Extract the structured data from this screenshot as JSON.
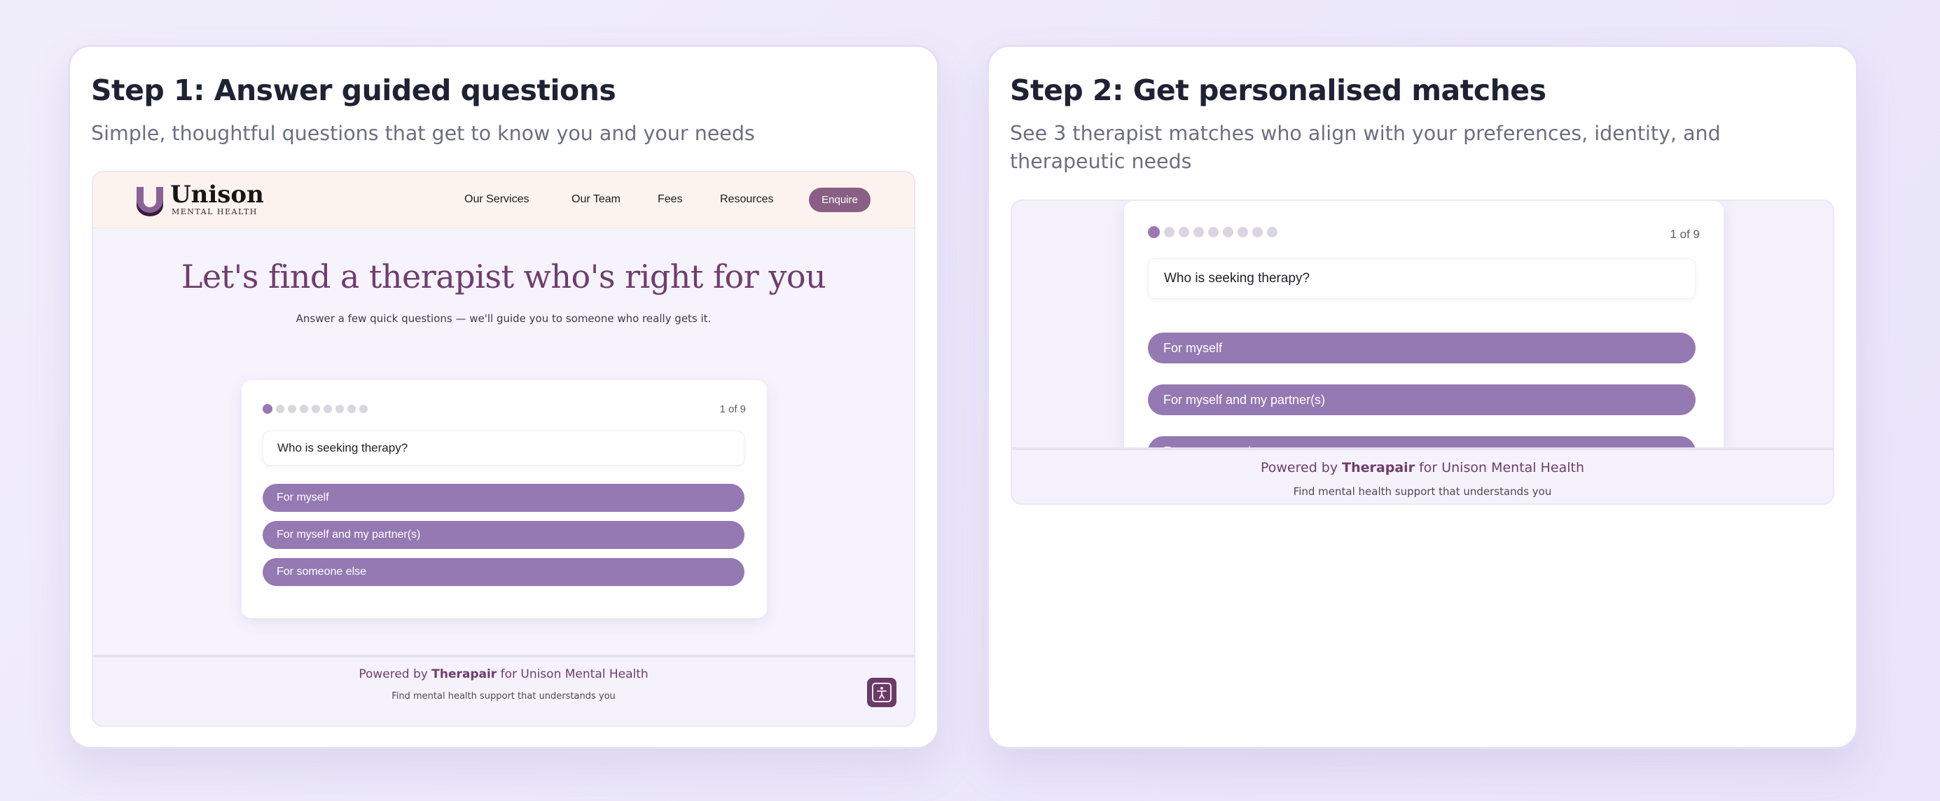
{
  "step1": {
    "title": "Step 1: Answer guided questions",
    "subtitle": "Simple, thoughtful questions that get to know you and your needs",
    "site": {
      "logo_word": "Unison",
      "logo_tagline": "MENTAL HEALTH",
      "nav": [
        "Our Services",
        "Our Team",
        "Fees",
        "Resources"
      ],
      "cta": "Enquire",
      "hero_title": "Let's find a therapist who's right for you",
      "hero_subtitle": "Answer a few quick questions — we'll guide you to someone who really gets it.",
      "quiz": {
        "progress": "1 of 9",
        "total_steps": 9,
        "current_step": 1,
        "question": "Who is seeking therapy?",
        "options": [
          "For myself",
          "For myself and my partner(s)",
          "For someone else"
        ]
      },
      "footer": {
        "powered_prefix": "Powered by ",
        "powered_brand": "Therapair",
        "powered_suffix": " for Unison Mental Health",
        "tagline": "Find mental health support that understands you"
      }
    }
  },
  "step2": {
    "title": "Step 2: Get personalised matches",
    "subtitle": "See 3 therapist matches who align with your preferences, identity, and therapeutic needs",
    "quiz": {
      "progress": "1 of 9",
      "question": "Who is seeking therapy?",
      "options": [
        "For myself",
        "For myself and my partner(s)",
        "For someone else"
      ]
    },
    "footer": {
      "powered_prefix": "Powered by ",
      "powered_brand": "Therapair",
      "powered_suffix": " for Unison Mental Health",
      "tagline": "Find mental health support that understands you"
    }
  },
  "colors": {
    "accent_purple": "#9579b2",
    "brand_plum": "#6f3d6c",
    "header_cream": "#fcf3ef",
    "dot_active": "#9a79b3",
    "dot_inactive": "#d9d6de"
  },
  "icons": {
    "logo": "unison-u-logo-icon",
    "accessibility": "accessibility-person-icon"
  }
}
